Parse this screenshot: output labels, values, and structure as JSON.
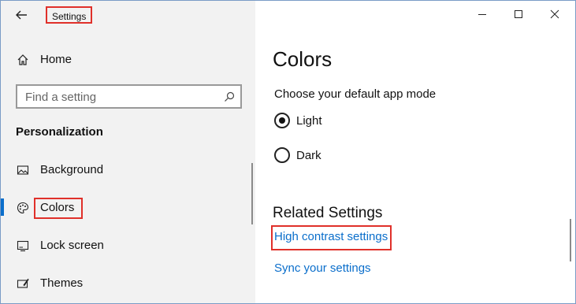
{
  "window": {
    "title": "Settings"
  },
  "sidebar": {
    "home_label": "Home",
    "search_placeholder": "Find a setting",
    "section_label": "Personalization",
    "items": [
      {
        "label": "Background",
        "icon": "image-icon"
      },
      {
        "label": "Colors",
        "icon": "palette-icon",
        "selected": true
      },
      {
        "label": "Lock screen",
        "icon": "lock-screen-icon"
      },
      {
        "label": "Themes",
        "icon": "themes-icon"
      }
    ]
  },
  "main": {
    "title": "Colors",
    "app_mode_label": "Choose your default app mode",
    "options": [
      {
        "label": "Light",
        "checked": true
      },
      {
        "label": "Dark",
        "checked": false
      }
    ],
    "related_title": "Related Settings",
    "links": [
      "High contrast settings",
      "Sync your settings"
    ]
  },
  "colors": {
    "accent": "#0a6ecb",
    "highlight": "#e0302a",
    "sidebar_bg": "#f2f2f2"
  }
}
